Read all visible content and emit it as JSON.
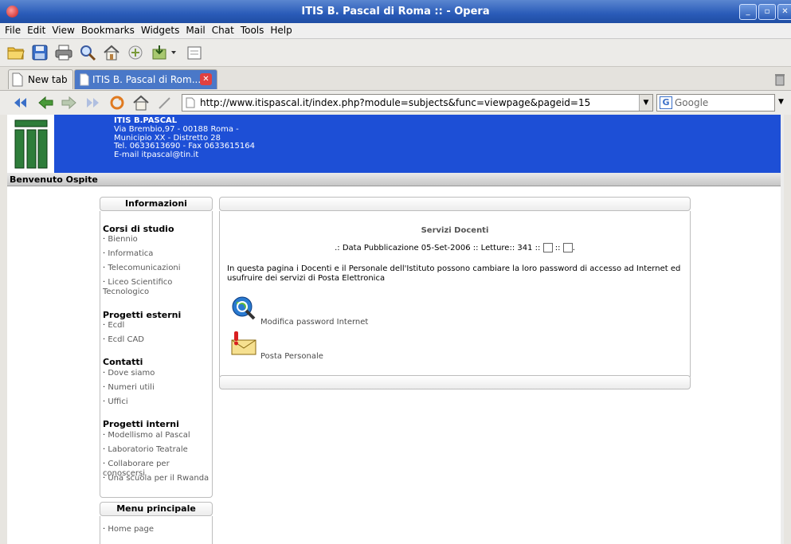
{
  "window": {
    "title": "ITIS B. Pascal di Roma :: - Opera"
  },
  "menu": [
    "File",
    "Edit",
    "View",
    "Bookmarks",
    "Widgets",
    "Mail",
    "Chat",
    "Tools",
    "Help"
  ],
  "tabs": [
    {
      "label": "New tab",
      "active": false
    },
    {
      "label": "ITIS B. Pascal di Rom...",
      "active": true
    }
  ],
  "address": {
    "url": "http://www.itispascal.it/index.php?module=subjects&func=viewpage&pageid=15",
    "search_placeholder": "Google"
  },
  "header": {
    "name": "ITIS B.PASCAL",
    "address": "Via Brembio,97 - 00188 Roma -",
    "district": "Municipio XX - Distretto 28",
    "phone": "Tel. 0633613690 - Fax 0633615164",
    "email": "E-mail itpascal@tin.it"
  },
  "welcome": "Benvenuto Ospite",
  "sidebar": {
    "info_title": "Informazioni",
    "sections": [
      {
        "title": "Corsi di studio",
        "items": [
          "Biennio",
          "Informatica",
          "Telecomunicazioni",
          "Liceo Scientifico Tecnologico"
        ]
      },
      {
        "title": "Progetti esterni",
        "items": [
          "Ecdl",
          "Ecdl CAD"
        ]
      },
      {
        "title": "Contatti",
        "items": [
          "Dove siamo",
          "Numeri utili",
          "Uffici"
        ]
      },
      {
        "title": "Progetti interni",
        "items": [
          "Modellismo al Pascal",
          "Laboratorio Teatrale",
          "Collaborare per conoscersi",
          "Una scuola per il Rwanda"
        ]
      }
    ],
    "menu_title": "Menu principale",
    "menu_items": [
      "Home page"
    ]
  },
  "content": {
    "title": "Servizi Docenti",
    "meta": ".: Data Pubblicazione 05-Set-2006 :: Letture:: 341 ::",
    "meta_end": ".",
    "meta_sep": "::",
    "description": "In questa pagina i Docenti e il Personale dell'Istituto possono cambiare la loro password di accesso ad Internet ed usufruire dei servizi di Posta Elettronica",
    "links": [
      "Modifica password Internet",
      "Posta Personale"
    ]
  },
  "colors": {
    "header_bg": "#1d4fd6",
    "logo_green": "#2e7d3a",
    "titlebar": "#2a5bb8"
  }
}
